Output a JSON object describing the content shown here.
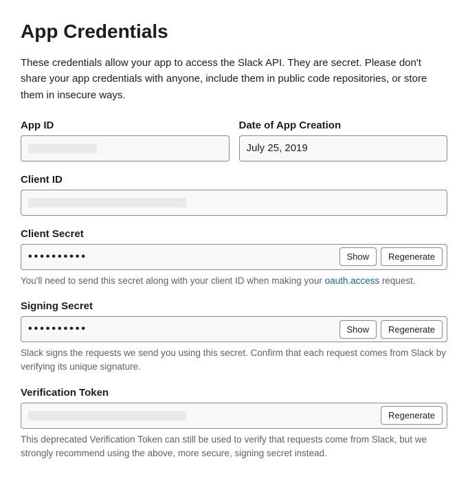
{
  "title": "App Credentials",
  "intro": "These credentials allow your app to access the Slack API. They are secret. Please don't share your app credentials with anyone, include them in public code repositories, or store them in insecure ways.",
  "fields": {
    "app_id": {
      "label": "App ID"
    },
    "date_created": {
      "label": "Date of App Creation",
      "value": "July 25, 2019"
    },
    "client_id": {
      "label": "Client ID"
    },
    "client_secret": {
      "label": "Client Secret",
      "masked": "••••••••••",
      "hint_pre": "You'll need to send this secret along with your client ID when making your ",
      "hint_link": "oauth.access",
      "hint_post": " request."
    },
    "signing_secret": {
      "label": "Signing Secret",
      "masked": "••••••••••",
      "hint": "Slack signs the requests we send you using this secret. Confirm that each request comes from Slack by verifying its unique signature."
    },
    "verification_token": {
      "label": "Verification Token",
      "hint": "This deprecated Verification Token can still be used to verify that requests come from Slack, but we strongly recommend using the above, more secure, signing secret instead."
    }
  },
  "buttons": {
    "show": "Show",
    "regenerate": "Regenerate"
  }
}
